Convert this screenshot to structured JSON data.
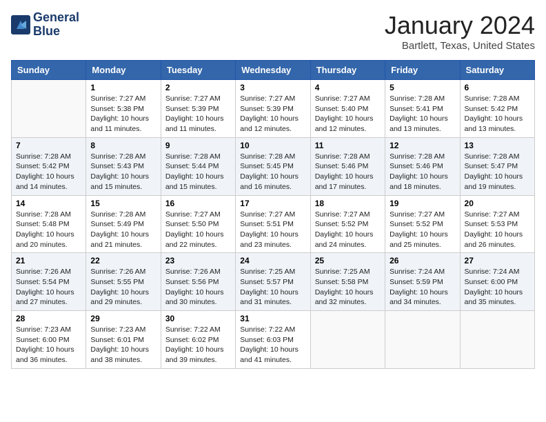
{
  "header": {
    "logo_line1": "General",
    "logo_line2": "Blue",
    "month_title": "January 2024",
    "location": "Bartlett, Texas, United States"
  },
  "weekdays": [
    "Sunday",
    "Monday",
    "Tuesday",
    "Wednesday",
    "Thursday",
    "Friday",
    "Saturday"
  ],
  "rows": [
    [
      {
        "day": "",
        "empty": true
      },
      {
        "day": "1",
        "sunrise": "7:27 AM",
        "sunset": "5:38 PM",
        "daylight": "10 hours and 11 minutes."
      },
      {
        "day": "2",
        "sunrise": "7:27 AM",
        "sunset": "5:39 PM",
        "daylight": "10 hours and 11 minutes."
      },
      {
        "day": "3",
        "sunrise": "7:27 AM",
        "sunset": "5:39 PM",
        "daylight": "10 hours and 12 minutes."
      },
      {
        "day": "4",
        "sunrise": "7:27 AM",
        "sunset": "5:40 PM",
        "daylight": "10 hours and 12 minutes."
      },
      {
        "day": "5",
        "sunrise": "7:28 AM",
        "sunset": "5:41 PM",
        "daylight": "10 hours and 13 minutes."
      },
      {
        "day": "6",
        "sunrise": "7:28 AM",
        "sunset": "5:42 PM",
        "daylight": "10 hours and 13 minutes."
      }
    ],
    [
      {
        "day": "7",
        "sunrise": "7:28 AM",
        "sunset": "5:42 PM",
        "daylight": "10 hours and 14 minutes."
      },
      {
        "day": "8",
        "sunrise": "7:28 AM",
        "sunset": "5:43 PM",
        "daylight": "10 hours and 15 minutes."
      },
      {
        "day": "9",
        "sunrise": "7:28 AM",
        "sunset": "5:44 PM",
        "daylight": "10 hours and 15 minutes."
      },
      {
        "day": "10",
        "sunrise": "7:28 AM",
        "sunset": "5:45 PM",
        "daylight": "10 hours and 16 minutes."
      },
      {
        "day": "11",
        "sunrise": "7:28 AM",
        "sunset": "5:46 PM",
        "daylight": "10 hours and 17 minutes."
      },
      {
        "day": "12",
        "sunrise": "7:28 AM",
        "sunset": "5:46 PM",
        "daylight": "10 hours and 18 minutes."
      },
      {
        "day": "13",
        "sunrise": "7:28 AM",
        "sunset": "5:47 PM",
        "daylight": "10 hours and 19 minutes."
      }
    ],
    [
      {
        "day": "14",
        "sunrise": "7:28 AM",
        "sunset": "5:48 PM",
        "daylight": "10 hours and 20 minutes."
      },
      {
        "day": "15",
        "sunrise": "7:28 AM",
        "sunset": "5:49 PM",
        "daylight": "10 hours and 21 minutes."
      },
      {
        "day": "16",
        "sunrise": "7:27 AM",
        "sunset": "5:50 PM",
        "daylight": "10 hours and 22 minutes."
      },
      {
        "day": "17",
        "sunrise": "7:27 AM",
        "sunset": "5:51 PM",
        "daylight": "10 hours and 23 minutes."
      },
      {
        "day": "18",
        "sunrise": "7:27 AM",
        "sunset": "5:52 PM",
        "daylight": "10 hours and 24 minutes."
      },
      {
        "day": "19",
        "sunrise": "7:27 AM",
        "sunset": "5:52 PM",
        "daylight": "10 hours and 25 minutes."
      },
      {
        "day": "20",
        "sunrise": "7:27 AM",
        "sunset": "5:53 PM",
        "daylight": "10 hours and 26 minutes."
      }
    ],
    [
      {
        "day": "21",
        "sunrise": "7:26 AM",
        "sunset": "5:54 PM",
        "daylight": "10 hours and 27 minutes."
      },
      {
        "day": "22",
        "sunrise": "7:26 AM",
        "sunset": "5:55 PM",
        "daylight": "10 hours and 29 minutes."
      },
      {
        "day": "23",
        "sunrise": "7:26 AM",
        "sunset": "5:56 PM",
        "daylight": "10 hours and 30 minutes."
      },
      {
        "day": "24",
        "sunrise": "7:25 AM",
        "sunset": "5:57 PM",
        "daylight": "10 hours and 31 minutes."
      },
      {
        "day": "25",
        "sunrise": "7:25 AM",
        "sunset": "5:58 PM",
        "daylight": "10 hours and 32 minutes."
      },
      {
        "day": "26",
        "sunrise": "7:24 AM",
        "sunset": "5:59 PM",
        "daylight": "10 hours and 34 minutes."
      },
      {
        "day": "27",
        "sunrise": "7:24 AM",
        "sunset": "6:00 PM",
        "daylight": "10 hours and 35 minutes."
      }
    ],
    [
      {
        "day": "28",
        "sunrise": "7:23 AM",
        "sunset": "6:00 PM",
        "daylight": "10 hours and 36 minutes."
      },
      {
        "day": "29",
        "sunrise": "7:23 AM",
        "sunset": "6:01 PM",
        "daylight": "10 hours and 38 minutes."
      },
      {
        "day": "30",
        "sunrise": "7:22 AM",
        "sunset": "6:02 PM",
        "daylight": "10 hours and 39 minutes."
      },
      {
        "day": "31",
        "sunrise": "7:22 AM",
        "sunset": "6:03 PM",
        "daylight": "10 hours and 41 minutes."
      },
      {
        "day": "",
        "empty": true
      },
      {
        "day": "",
        "empty": true
      },
      {
        "day": "",
        "empty": true
      }
    ]
  ]
}
